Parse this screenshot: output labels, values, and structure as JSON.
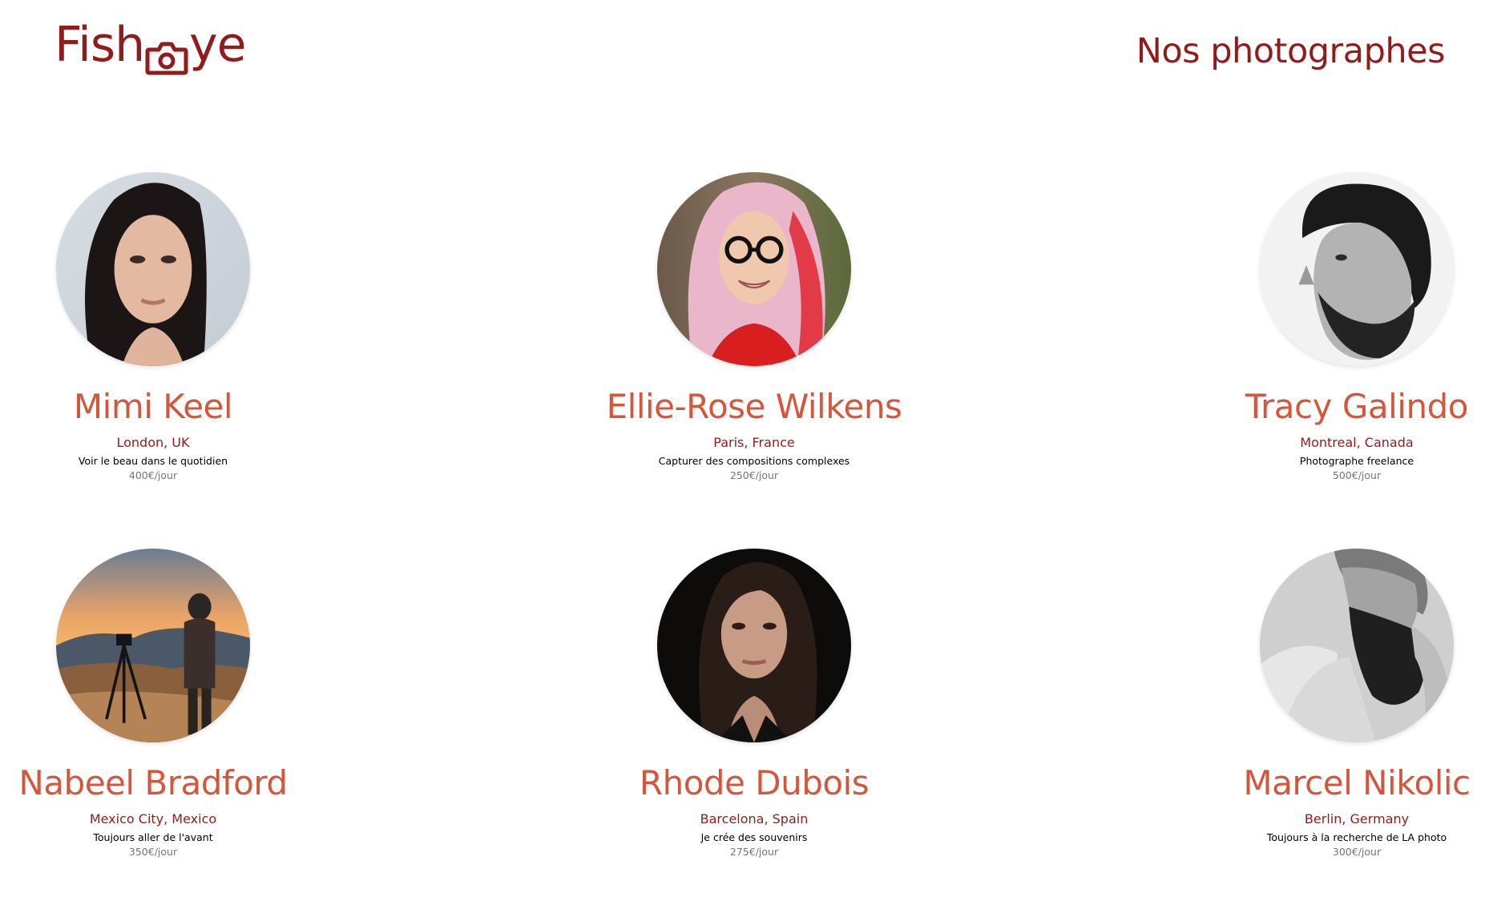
{
  "colors": {
    "brand_primary": "#901C1C",
    "brand_secondary": "#D3573C",
    "text_dark": "#000000",
    "text_muted": "#757575",
    "background": "#FFFFFF"
  },
  "header": {
    "logo_left": "Fish",
    "logo_icon": "camera-icon",
    "logo_right": "ye",
    "title": "Nos photographes"
  },
  "photographers": [
    {
      "name": "Mimi Keel",
      "location": "London, UK",
      "tagline": "Voir le beau dans le quotidien",
      "price": "400€/jour",
      "portrait": "portrait-photo"
    },
    {
      "name": "Ellie-Rose Wilkens",
      "location": "Paris, France",
      "tagline": "Capturer des compositions complexes",
      "price": "250€/jour",
      "portrait": "portrait-photo"
    },
    {
      "name": "Tracy Galindo",
      "location": "Montreal, Canada",
      "tagline": "Photographe freelance",
      "price": "500€/jour",
      "portrait": "portrait-photo"
    },
    {
      "name": "Nabeel Bradford",
      "location": "Mexico City, Mexico",
      "tagline": "Toujours aller de l'avant",
      "price": "350€/jour",
      "portrait": "portrait-photo"
    },
    {
      "name": "Rhode Dubois",
      "location": "Barcelona, Spain",
      "tagline": "Je crée des souvenirs",
      "price": "275€/jour",
      "portrait": "portrait-photo"
    },
    {
      "name": "Marcel Nikolic",
      "location": "Berlin, Germany",
      "tagline": "Toujours à la recherche de LA photo",
      "price": "300€/jour",
      "portrait": "portrait-photo"
    }
  ]
}
